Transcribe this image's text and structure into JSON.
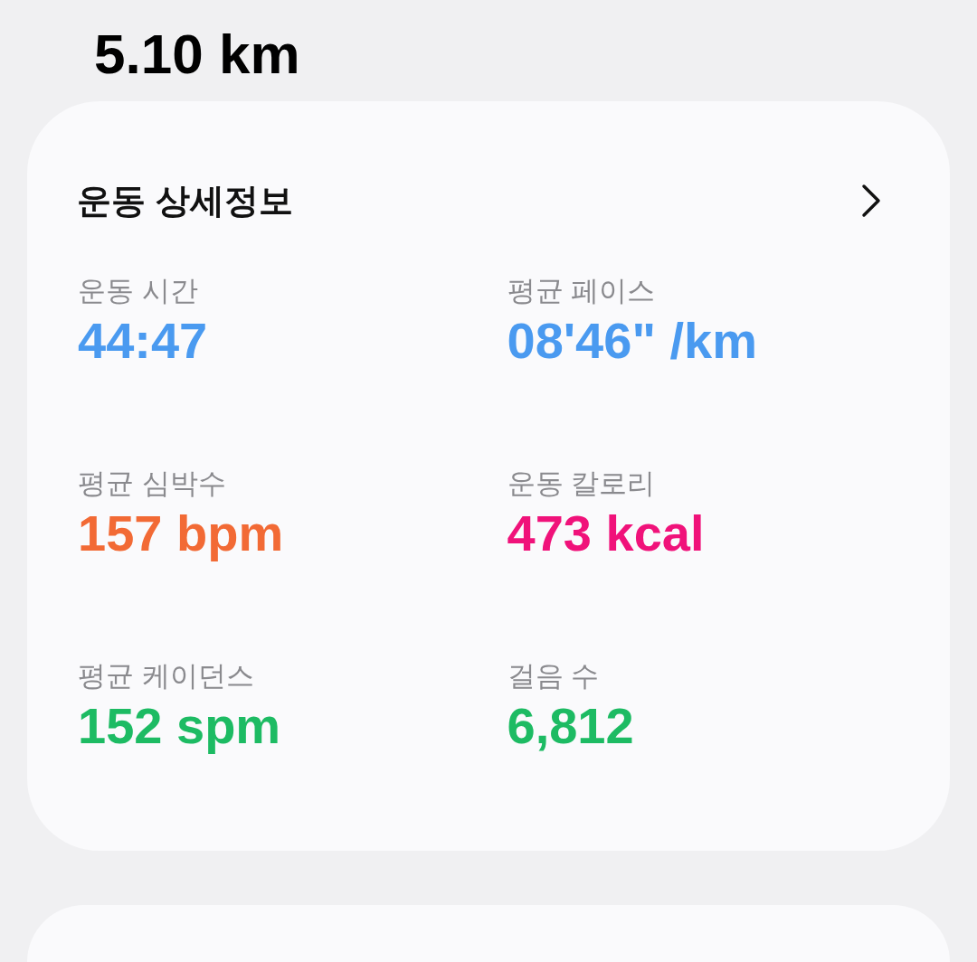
{
  "distance": "5.10 km",
  "card": {
    "title": "운동 상세정보",
    "stats": [
      {
        "label": "운동 시간",
        "value": "44:47",
        "color": "#4a9af0"
      },
      {
        "label": "평균 페이스",
        "value": "08'46\" /km",
        "color": "#4a9af0"
      },
      {
        "label": "평균 심박수",
        "value": "157 bpm",
        "color": "#f26a35"
      },
      {
        "label": "운동 칼로리",
        "value": "473 kcal",
        "color": "#f0127a"
      },
      {
        "label": "평균 케이던스",
        "value": "152 spm",
        "color": "#1dbb63"
      },
      {
        "label": "걸음 수",
        "value": "6,812",
        "color": "#1dbb63"
      }
    ]
  }
}
